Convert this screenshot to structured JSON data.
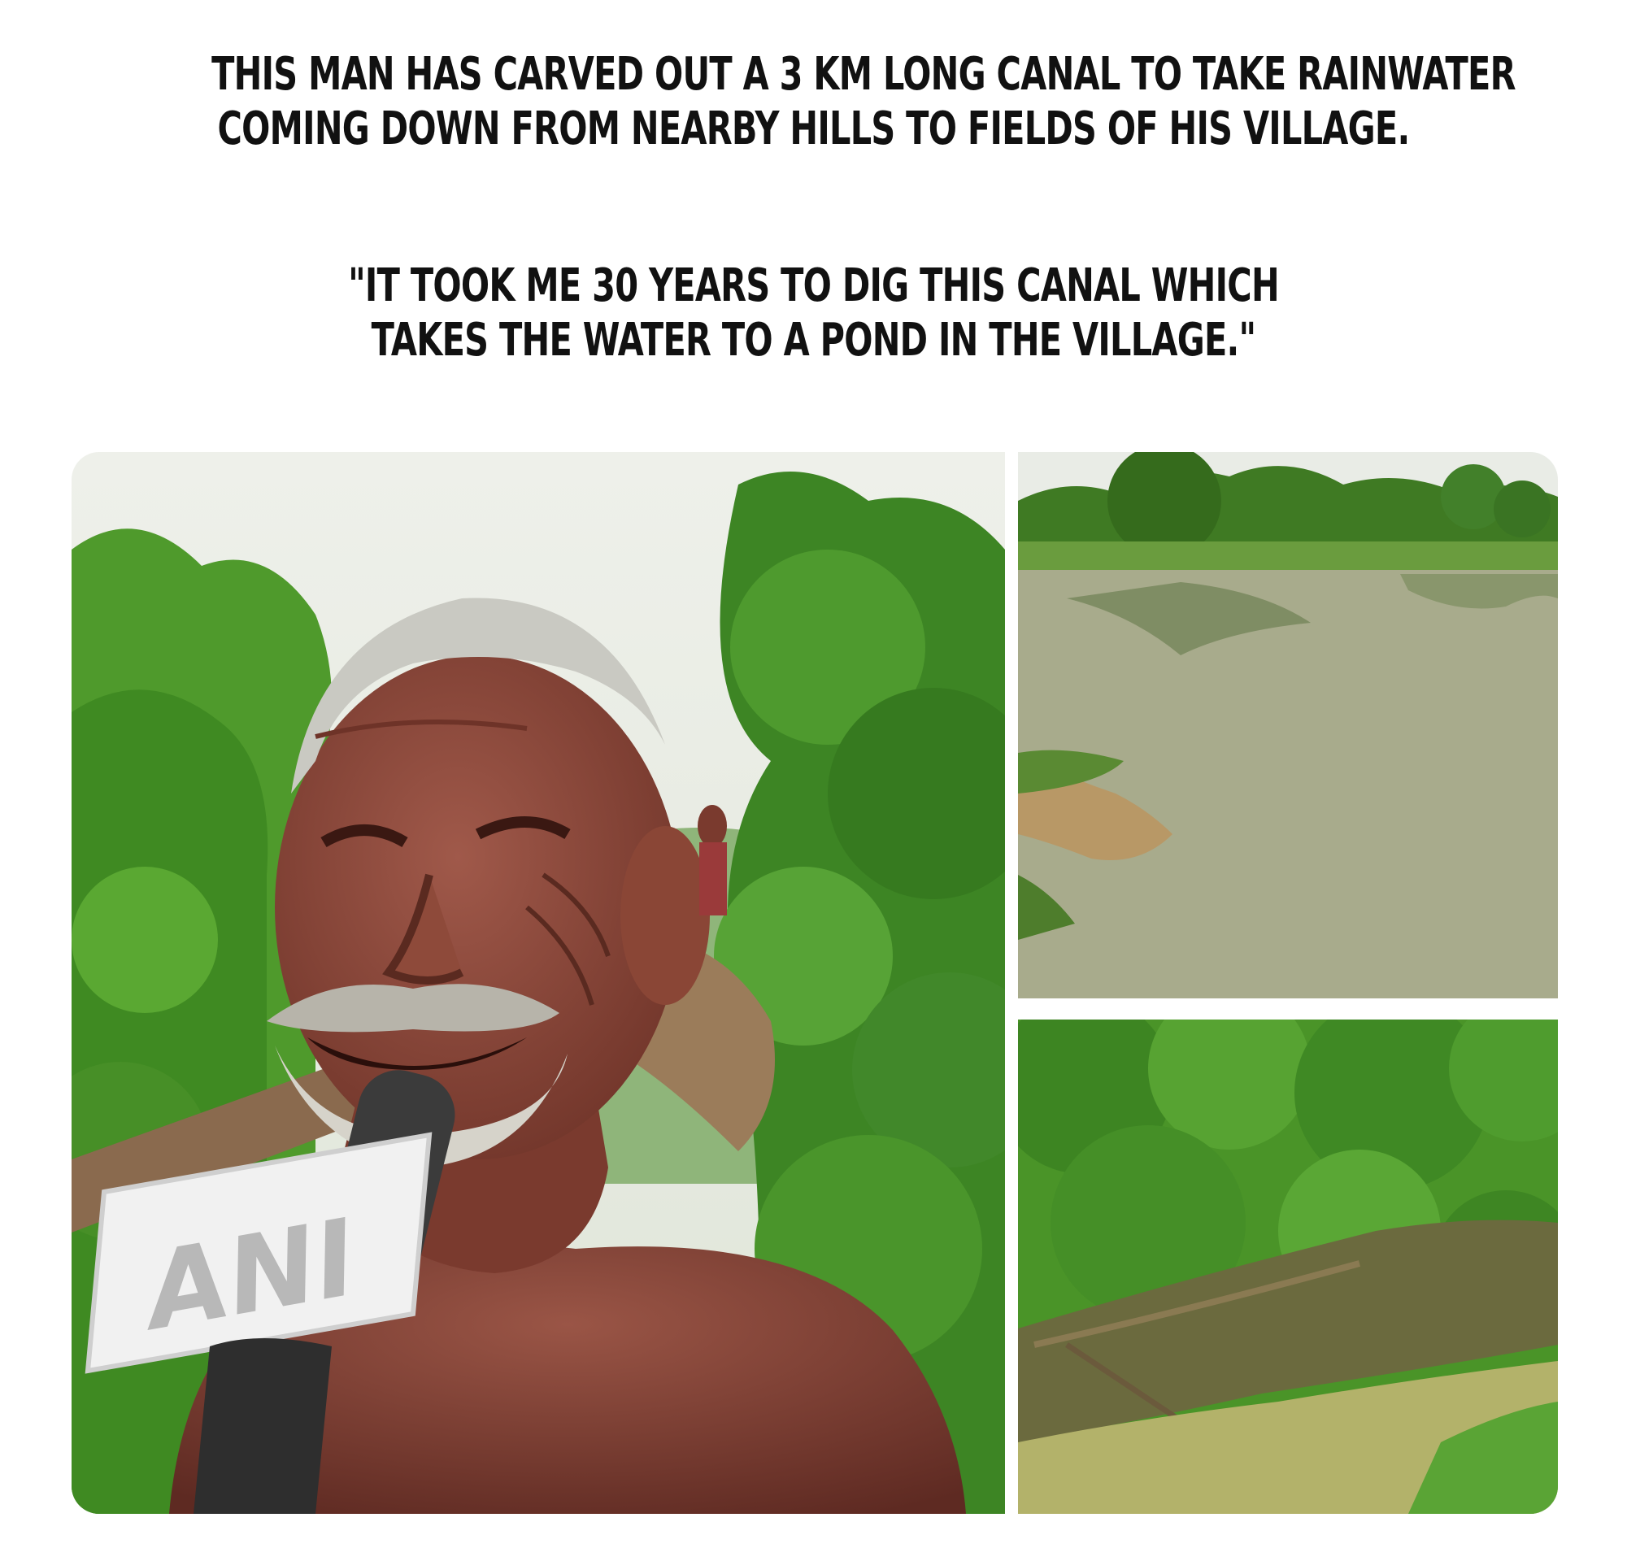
{
  "caption": {
    "headline_line1": "THIS MAN HAS CARVED OUT A 3 KM LONG CANAL TO TAKE RAINWATER",
    "headline_line2": "COMING DOWN FROM NEARBY HILLS TO FIELDS OF HIS VILLAGE.",
    "quote_line1": "\"IT TOOK ME 30 YEARS TO DIG THIS CANAL WHICH",
    "quote_line2": "TAKES THE WATER TO A POND IN THE VILLAGE.\""
  },
  "photos": {
    "man": {
      "microphone_logo": "ANI"
    }
  },
  "colors": {
    "text": "#111111",
    "background": "#ffffff",
    "foliage": "#4f9a2c",
    "skin": "#8a4a3c",
    "pond_water": "#a8ab8c",
    "canal_water": "#b3b26a"
  }
}
